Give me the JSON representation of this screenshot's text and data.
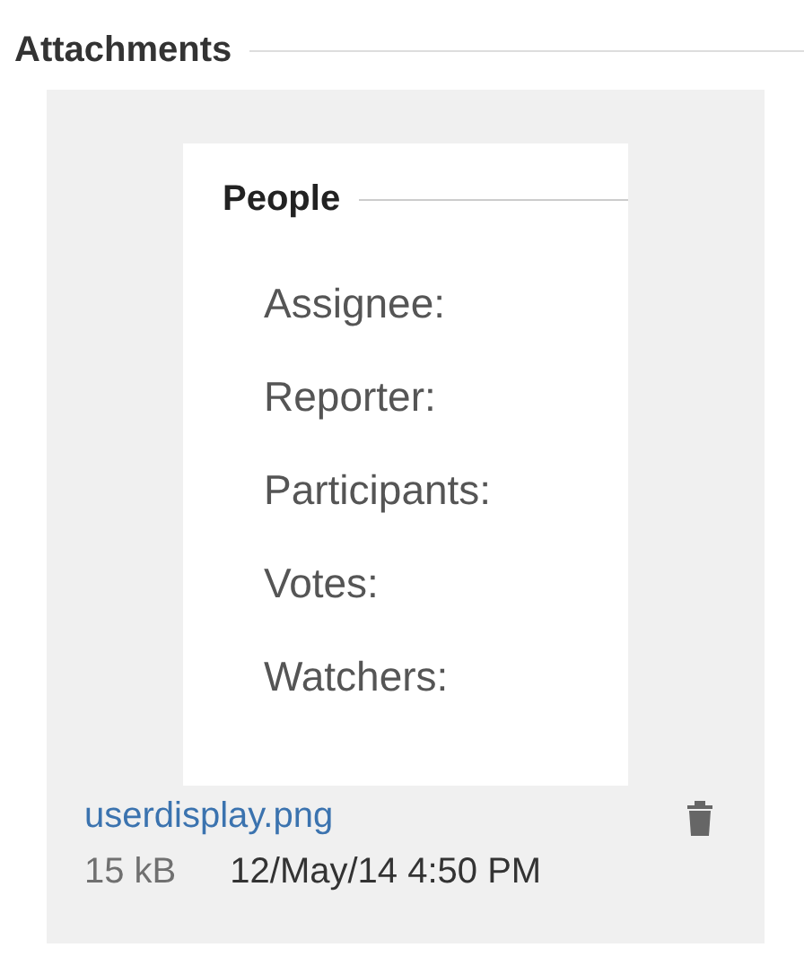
{
  "section": {
    "title": "Attachments"
  },
  "attachment": {
    "preview": {
      "heading": "People",
      "fields": [
        "Assignee:",
        "Reporter:",
        "Participants:",
        "Votes:",
        "Watchers:"
      ]
    },
    "filename": "userdisplay.png",
    "size": "15 kB",
    "date": "12/May/14 4:50 PM"
  }
}
